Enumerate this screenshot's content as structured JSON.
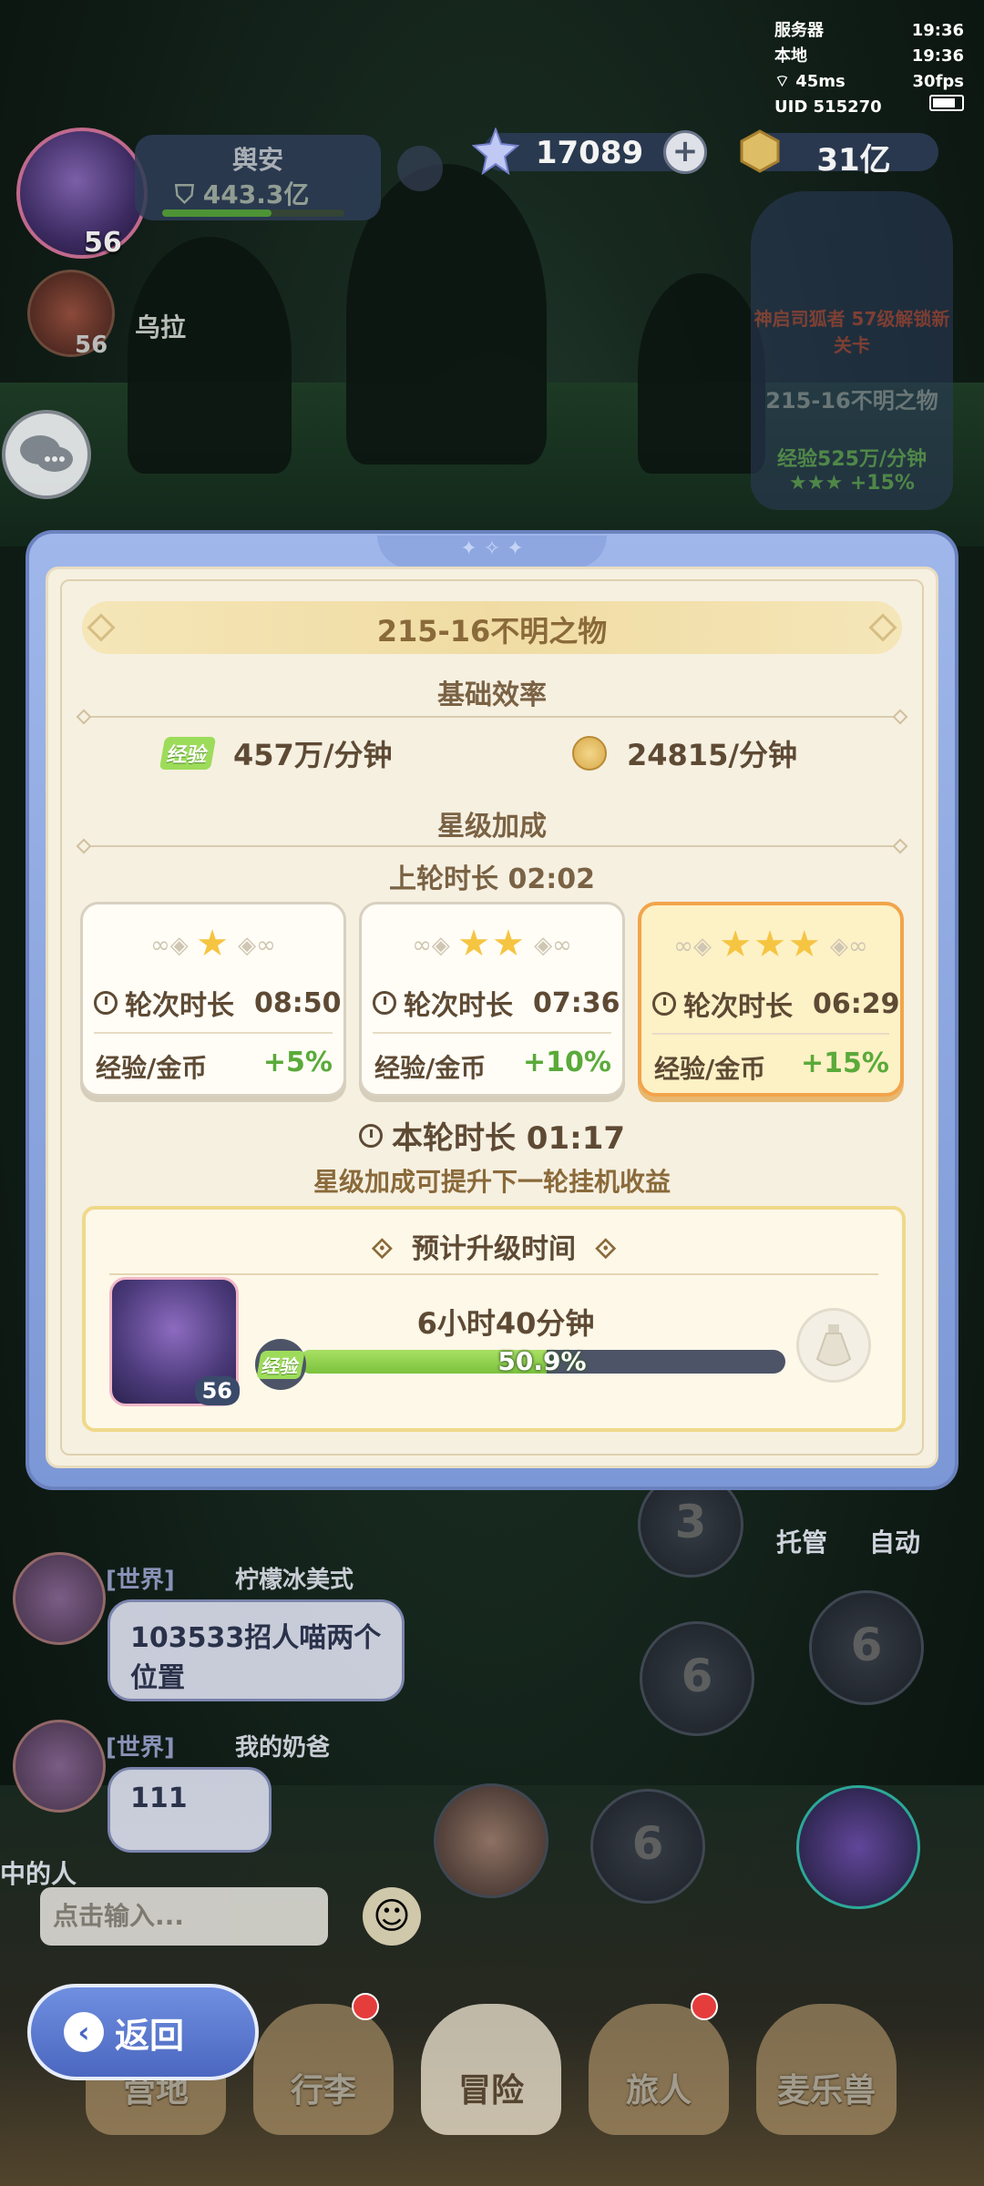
{
  "status_bar": {
    "server_label": "服务器",
    "server_time": "19:36",
    "local_label": "本地",
    "local_time": "19:36",
    "ping": "45ms",
    "fps": "30fps",
    "uid": "UID 515270"
  },
  "player": {
    "level": "56",
    "name": "舆安",
    "power": "443.3亿",
    "exp_fraction": 0.6
  },
  "friend": {
    "level": "56",
    "name": "乌拉"
  },
  "currencies": {
    "gems": "17089",
    "gold": "31亿"
  },
  "stage_card": {
    "unlock_text": "神启司狐者 57级解锁新关卡",
    "stage": "215-16不明之物",
    "exp_rate": "经验525万/分钟",
    "bonus": "+15%"
  },
  "modal": {
    "title": "215-16不明之物",
    "base_efficiency_label": "基础效率",
    "exp_tag": "经验",
    "exp_rate": "457万/分钟",
    "gold_rate": "24815/分钟",
    "star_bonus_label": "星级加成",
    "last_round": "上轮时长  02:02",
    "cards": [
      {
        "stars": 1,
        "time_label": "轮次时长",
        "time": "08:50",
        "reward_label": "经验/金币",
        "bonus": "+5%",
        "selected": false
      },
      {
        "stars": 2,
        "time_label": "轮次时长",
        "time": "07:36",
        "reward_label": "经验/金币",
        "bonus": "+10%",
        "selected": false
      },
      {
        "stars": 3,
        "time_label": "轮次时长",
        "time": "06:29",
        "reward_label": "经验/金币",
        "bonus": "+15%",
        "selected": true
      }
    ],
    "current_round": "本轮时长  01:17",
    "hint": "星级加成可提升下一轮挂机收益",
    "upgrade": {
      "header": "预计升级时间",
      "avatar_level": "56",
      "time": "6小时40分钟",
      "exp_tag": "经验",
      "progress_text": "50.9%",
      "progress": 0.509
    }
  },
  "chat": {
    "messages": [
      {
        "channel": "[世界]",
        "name": "柠檬冰美式",
        "text": "103533招人喵两个位置"
      },
      {
        "channel": "[世界]",
        "name": "我的奶爸",
        "text": "111"
      }
    ],
    "side_text": "中的人",
    "input_placeholder": "点击输入..."
  },
  "right_controls": {
    "auto_manage": "托管",
    "auto": "自动"
  },
  "skills": [
    "3",
    "6",
    "6",
    "6"
  ],
  "back_button": "返回",
  "nav": [
    "营地",
    "行李",
    "冒险",
    "旅人",
    "麦乐兽"
  ],
  "colors": {
    "accent_blue": "#7c97d6",
    "bonus_green": "#5aaa3a",
    "selected_border": "#f2a44a",
    "exp_bar": "#7cc23e"
  }
}
